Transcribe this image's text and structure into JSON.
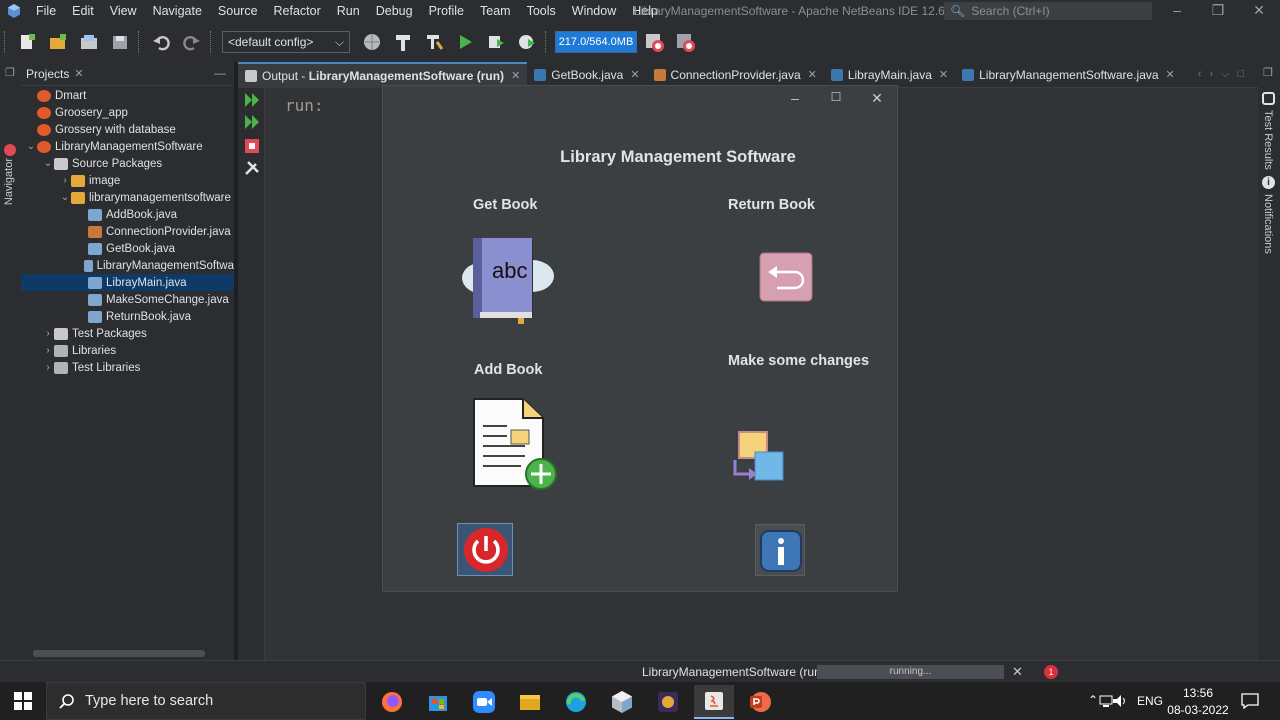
{
  "menubar": {
    "items": [
      "File",
      "Edit",
      "View",
      "Navigate",
      "Source",
      "Refactor",
      "Run",
      "Debug",
      "Profile",
      "Team",
      "Tools",
      "Window",
      "Help"
    ],
    "window_title": "LibraryManagementSoftware - Apache NetBeans IDE 12.6",
    "search_placeholder": "Search (Ctrl+I)"
  },
  "toolbar": {
    "config": "<default config>",
    "memory": "217.0/564.0MB"
  },
  "left_strip": {
    "navigator_label": "Navigator"
  },
  "projects": {
    "tab_label": "Projects",
    "tree": [
      {
        "label": "Dmart",
        "depth": 0,
        "arrow": "",
        "icon": "java-project-icon"
      },
      {
        "label": "Groosery_app",
        "depth": 0,
        "arrow": "",
        "icon": "java-project-icon"
      },
      {
        "label": "Grossery with database",
        "depth": 0,
        "arrow": "",
        "icon": "java-project-icon"
      },
      {
        "label": "LibraryManagementSoftware",
        "depth": 0,
        "arrow": "v",
        "icon": "java-project-icon"
      },
      {
        "label": "Source Packages",
        "depth": 1,
        "arrow": "v",
        "icon": "folder-icon"
      },
      {
        "label": "image",
        "depth": 2,
        "arrow": ">",
        "icon": "package-icon"
      },
      {
        "label": "librarymanagementsoftware",
        "depth": 2,
        "arrow": "v",
        "icon": "package-icon"
      },
      {
        "label": "AddBook.java",
        "depth": 3,
        "arrow": "",
        "icon": "form-file-icon"
      },
      {
        "label": "ConnectionProvider.java",
        "depth": 3,
        "arrow": "",
        "icon": "java-file-icon"
      },
      {
        "label": "GetBook.java",
        "depth": 3,
        "arrow": "",
        "icon": "form-file-icon"
      },
      {
        "label": "LibraryManagementSoftwa",
        "depth": 3,
        "arrow": "",
        "icon": "form-file-icon"
      },
      {
        "label": "LibrayMain.java",
        "depth": 3,
        "arrow": "",
        "icon": "form-file-icon",
        "selected": true
      },
      {
        "label": "MakeSomeChange.java",
        "depth": 3,
        "arrow": "",
        "icon": "form-file-icon"
      },
      {
        "label": "ReturnBook.java",
        "depth": 3,
        "arrow": "",
        "icon": "form-file-icon"
      },
      {
        "label": "Test Packages",
        "depth": 1,
        "arrow": ">",
        "icon": "folder-icon"
      },
      {
        "label": "Libraries",
        "depth": 1,
        "arrow": ">",
        "icon": "library-icon"
      },
      {
        "label": "Test Libraries",
        "depth": 1,
        "arrow": ">",
        "icon": "library-icon"
      }
    ]
  },
  "editor_tabs": {
    "output_tab_prefix": "Output - ",
    "output_tab_name": "LibraryManagementSoftware (run)",
    "file_tabs": [
      "GetBook.java",
      "ConnectionProvider.java",
      "LibrayMain.java",
      "LibraryManagementSoftware.java"
    ]
  },
  "output": {
    "run_text": "run:"
  },
  "right_strip": {
    "test_results": "Test Results",
    "notifications": "Notifications"
  },
  "library_app": {
    "title": "Library Management Software",
    "get_book": "Get Book",
    "return_book": "Return Book",
    "add_book": "Add Book",
    "make_changes": "Make some changes",
    "book_icon_text": "abc"
  },
  "statusbar": {
    "task": "LibraryManagementSoftware (run)",
    "progress_text": "running...",
    "notification_count": "1"
  },
  "taskbar": {
    "search_placeholder": "Type here to search",
    "apps": [
      "firefox-icon",
      "store-icon",
      "zoom-icon",
      "file-explorer-icon",
      "edge-icon",
      "netbeans-icon",
      "game-icon",
      "java-icon",
      "powerpoint-icon"
    ],
    "lang": "ENG",
    "time": "13:56",
    "date": "08-03-2022"
  },
  "colors": {
    "accent": "#1f7ad6",
    "power_red": "#d8262b",
    "info_blue": "#3f77b6"
  }
}
